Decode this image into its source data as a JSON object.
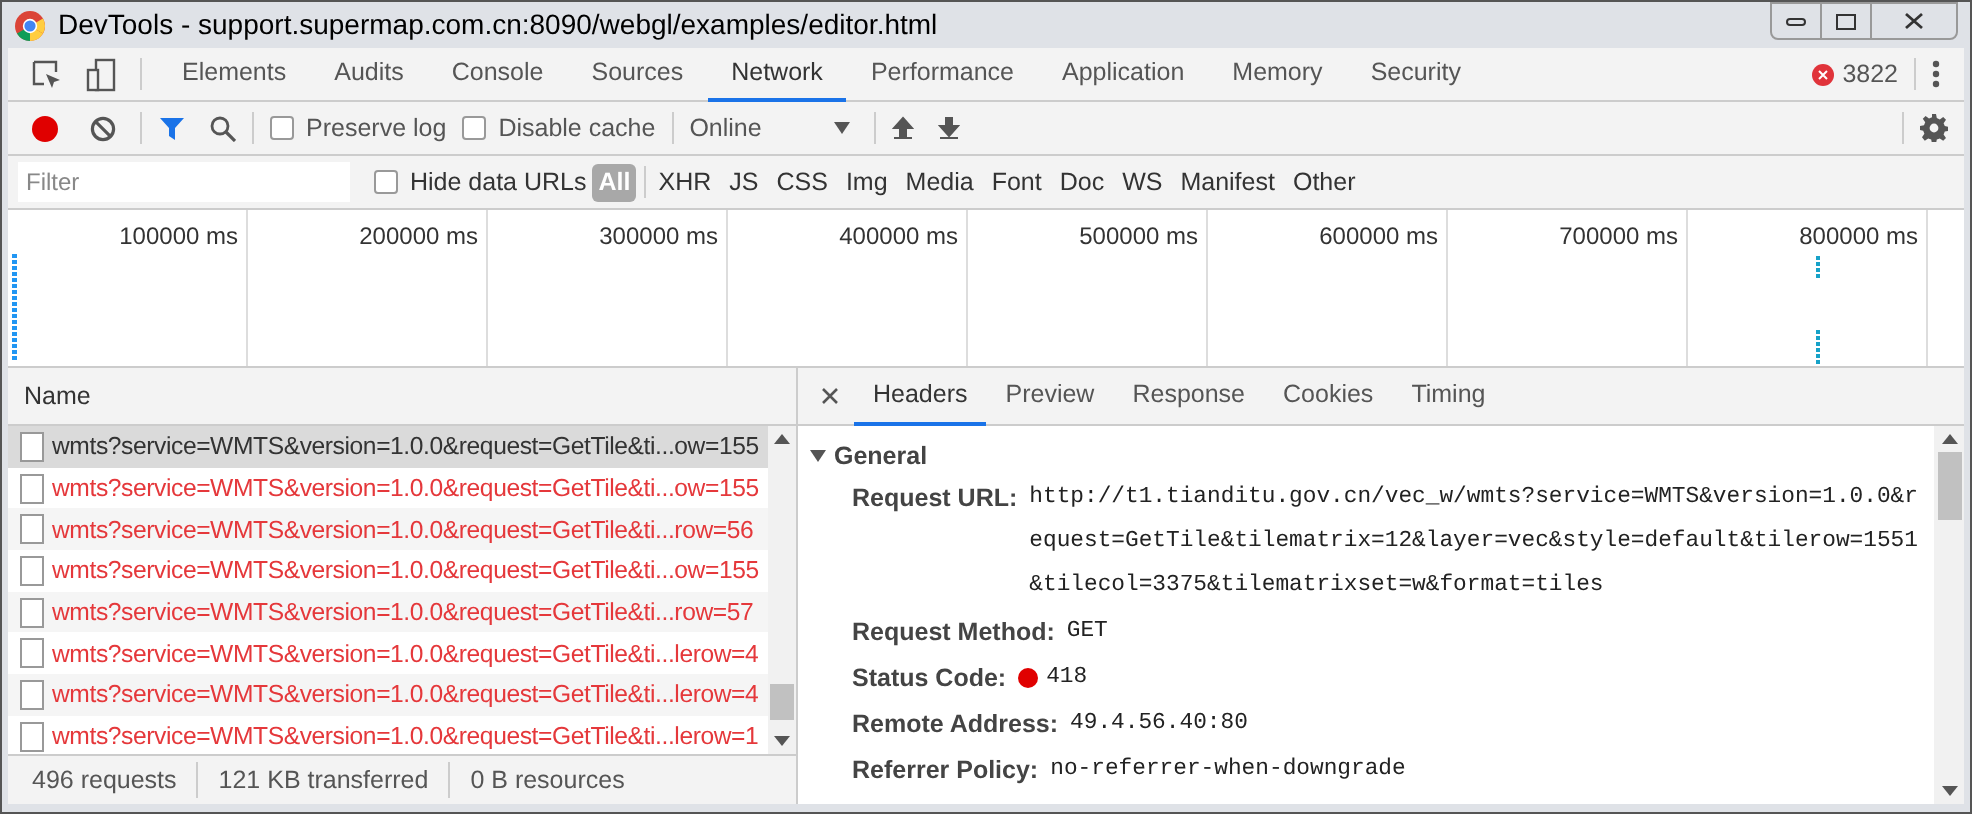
{
  "window": {
    "title": "DevTools - support.supermap.com.cn:8090/webgl/examples/editor.html"
  },
  "tabs": [
    {
      "label": "Elements",
      "selected": false
    },
    {
      "label": "Audits",
      "selected": false
    },
    {
      "label": "Console",
      "selected": false
    },
    {
      "label": "Sources",
      "selected": false
    },
    {
      "label": "Network",
      "selected": true
    },
    {
      "label": "Performance",
      "selected": false
    },
    {
      "label": "Application",
      "selected": false
    },
    {
      "label": "Memory",
      "selected": false
    },
    {
      "label": "Security",
      "selected": false
    }
  ],
  "error_count": "3822",
  "toolbar": {
    "recording": true,
    "filter_on": true,
    "preserve_log": {
      "label": "Preserve log",
      "checked": false
    },
    "disable_cache": {
      "label": "Disable cache",
      "checked": false
    },
    "throttling": "Online"
  },
  "filter_bar": {
    "placeholder": "Filter",
    "hide_data_urls": {
      "label": "Hide data URLs",
      "checked": false
    },
    "types": [
      {
        "label": "All",
        "selected": true
      },
      {
        "label": "XHR",
        "selected": false
      },
      {
        "label": "JS",
        "selected": false
      },
      {
        "label": "CSS",
        "selected": false
      },
      {
        "label": "Img",
        "selected": false
      },
      {
        "label": "Media",
        "selected": false
      },
      {
        "label": "Font",
        "selected": false
      },
      {
        "label": "Doc",
        "selected": false
      },
      {
        "label": "WS",
        "selected": false
      },
      {
        "label": "Manifest",
        "selected": false
      },
      {
        "label": "Other",
        "selected": false
      }
    ]
  },
  "overview": {
    "ticks": [
      "100000 ms",
      "200000 ms",
      "300000 ms",
      "400000 ms",
      "500000 ms",
      "600000 ms",
      "700000 ms",
      "800000 ms"
    ]
  },
  "requests": {
    "column": "Name",
    "rows": [
      {
        "name": "wmts?service=WMTS&version=1.0.0&request=GetTile&ti...ow=155",
        "selected": true,
        "failed": false
      },
      {
        "name": "wmts?service=WMTS&version=1.0.0&request=GetTile&ti...ow=155",
        "selected": false,
        "failed": true
      },
      {
        "name": "wmts?service=WMTS&version=1.0.0&request=GetTile&ti...row=56",
        "selected": false,
        "failed": true
      },
      {
        "name": "wmts?service=WMTS&version=1.0.0&request=GetTile&ti...ow=155",
        "selected": false,
        "failed": true
      },
      {
        "name": "wmts?service=WMTS&version=1.0.0&request=GetTile&ti...row=57",
        "selected": false,
        "failed": true
      },
      {
        "name": "wmts?service=WMTS&version=1.0.0&request=GetTile&ti...lerow=4",
        "selected": false,
        "failed": true
      },
      {
        "name": "wmts?service=WMTS&version=1.0.0&request=GetTile&ti...lerow=4",
        "selected": false,
        "failed": true
      },
      {
        "name": "wmts?service=WMTS&version=1.0.0&request=GetTile&ti...lerow=1",
        "selected": false,
        "failed": true
      }
    ]
  },
  "status_bar": [
    "496 requests",
    "121 KB transferred",
    "0 B resources"
  ],
  "detail": {
    "tabs": [
      {
        "label": "Headers",
        "selected": true
      },
      {
        "label": "Preview",
        "selected": false
      },
      {
        "label": "Response",
        "selected": false
      },
      {
        "label": "Cookies",
        "selected": false
      },
      {
        "label": "Timing",
        "selected": false
      }
    ],
    "section": {
      "title": "General",
      "expanded": true,
      "fields": [
        {
          "label": "Request URL:",
          "value": "http://t1.tianditu.gov.cn/vec_w/wmts?service=WMTS&version=1.0.0&request=GetTile&tilematrix=12&layer=vec&style=default&tilerow=1551&tilecol=3375&tilematrixset=w&format=tiles"
        },
        {
          "label": "Request Method:",
          "value": "GET"
        },
        {
          "label": "Status Code:",
          "value": "418",
          "color": "#e00000"
        },
        {
          "label": "Remote Address:",
          "value": "49.4.56.40:80"
        },
        {
          "label": "Referrer Policy:",
          "value": "no-referrer-when-downgrade"
        }
      ]
    }
  }
}
